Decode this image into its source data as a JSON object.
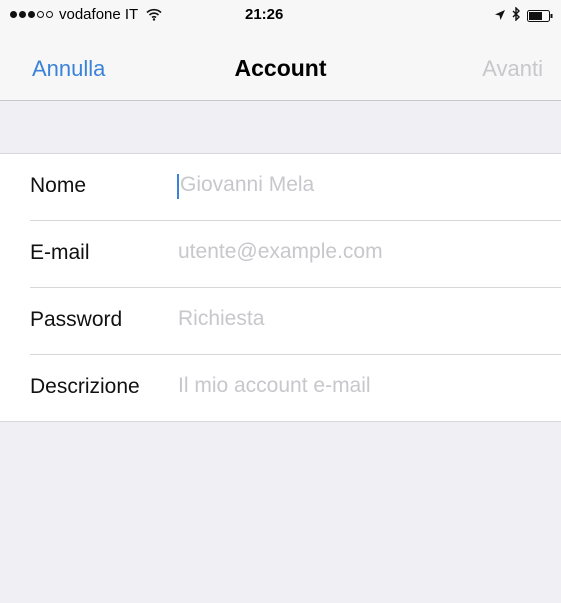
{
  "status_bar": {
    "carrier": "vodafone IT",
    "time": "21:26"
  },
  "nav": {
    "cancel_label": "Annulla",
    "title": "Account",
    "next_label": "Avanti"
  },
  "form": {
    "rows": [
      {
        "label": "Nome",
        "placeholder": "Giovanni Mela"
      },
      {
        "label": "E-mail",
        "placeholder": "utente@example.com"
      },
      {
        "label": "Password",
        "placeholder": "Richiesta"
      },
      {
        "label": "Descrizione",
        "placeholder": "Il mio account e-mail"
      }
    ]
  },
  "colors": {
    "accent": "#3b82d9",
    "disabled": "#c7c7cc",
    "background": "#efeff4"
  }
}
